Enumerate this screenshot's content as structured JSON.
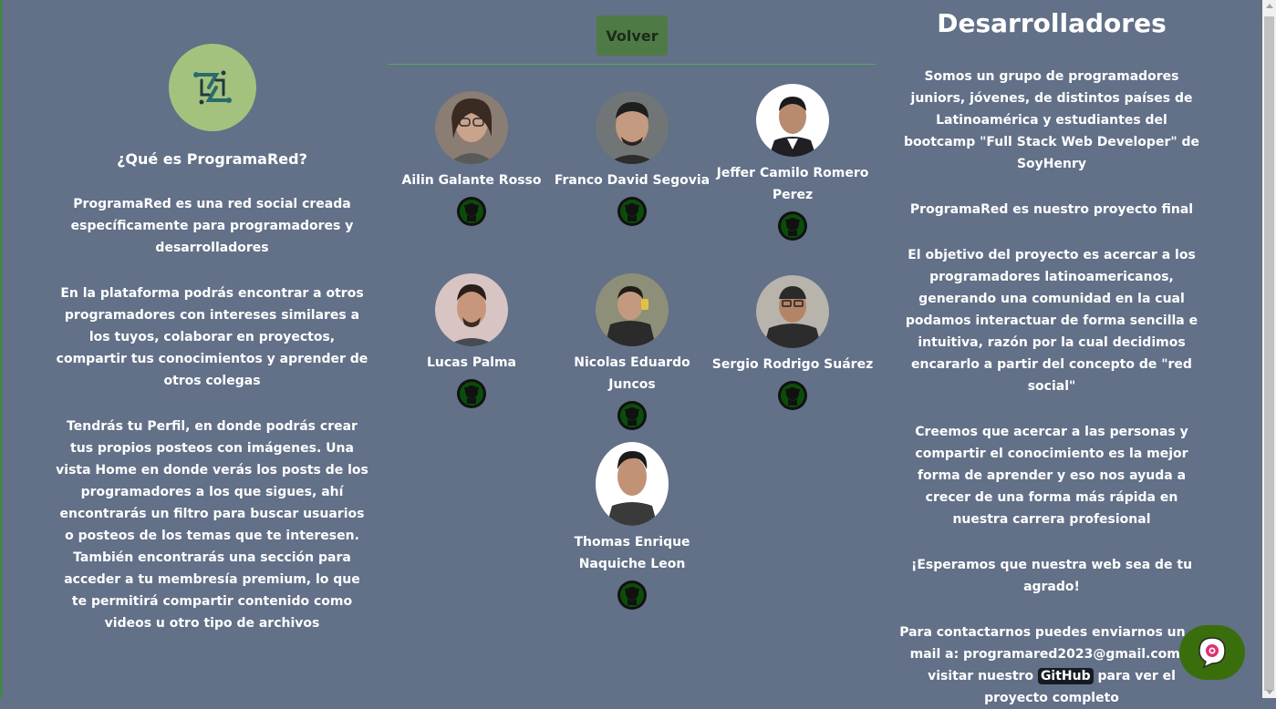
{
  "about": {
    "title": "¿Qué es ProgramaRed?",
    "p1": "ProgramaRed es una red social creada específicamente para programadores y desarrolladores",
    "p2": "En la plataforma podrás encontrar a otros programadores con intereses similares a los tuyos, colaborar en proyectos, compartir tus conocimientos y aprender de otros colegas",
    "p3": "Tendrás tu Perfil, en donde podrás crear tus propios posteos con imágenes. Una vista Home en donde verás los posts de los programadores a los que sigues, ahí encontrarás un filtro para buscar usuarios o posteos de los temas que te interesen. También encontrarás una sección para acceder a tu membresía premium, lo que te permitirá compartir contenido como videos u otro tipo de archivos"
  },
  "nav": {
    "back_label": "Volver"
  },
  "developers": [
    {
      "name": "Ailin Galante Rosso"
    },
    {
      "name": "Franco David Segovia"
    },
    {
      "name": "Jeffer Camilo Romero Perez"
    },
    {
      "name": "Lucas Palma"
    },
    {
      "name": "Nicolas Eduardo Juncos"
    },
    {
      "name": "Sergio Rodrigo Suárez"
    },
    {
      "name": "Thomas Enrique Naquiche Leon"
    }
  ],
  "devs_section": {
    "title": "Desarrolladores",
    "p1": "Somos un grupo de programadores juniors, jóvenes, de distintos países de Latinoamérica y estudiantes del bootcamp \"Full Stack Web Developer\" de SoyHenry",
    "p2": "ProgramaRed es nuestro proyecto final",
    "p3": "El objetivo del proyecto es acercar a los programadores latinoamericanos, generando una comunidad en la cual podamos interactuar de forma sencilla e intuitiva, razón por la cual decidimos encararlo a partir del concepto de \"red social\"",
    "p4": "Creemos que acercar a las personas y compartir el conocimiento es la mejor forma de aprender y eso nos ayuda a crecer de una forma más rápida en nuestra carrera profesional",
    "p5": "¡Esperamos que nuestra web sea de tu agrado!",
    "contact_pre": "Para contactarnos puedes enviarnos un e-mail a: programared2023@gmail.com o visitar nuestro",
    "contact_link": "GitHub",
    "contact_post": "para ver el proyecto completo"
  },
  "colors": {
    "background": "#627088",
    "button": "#4e7a45",
    "chat": "#3a6e0c",
    "logo_bg": "#a4c27e"
  }
}
